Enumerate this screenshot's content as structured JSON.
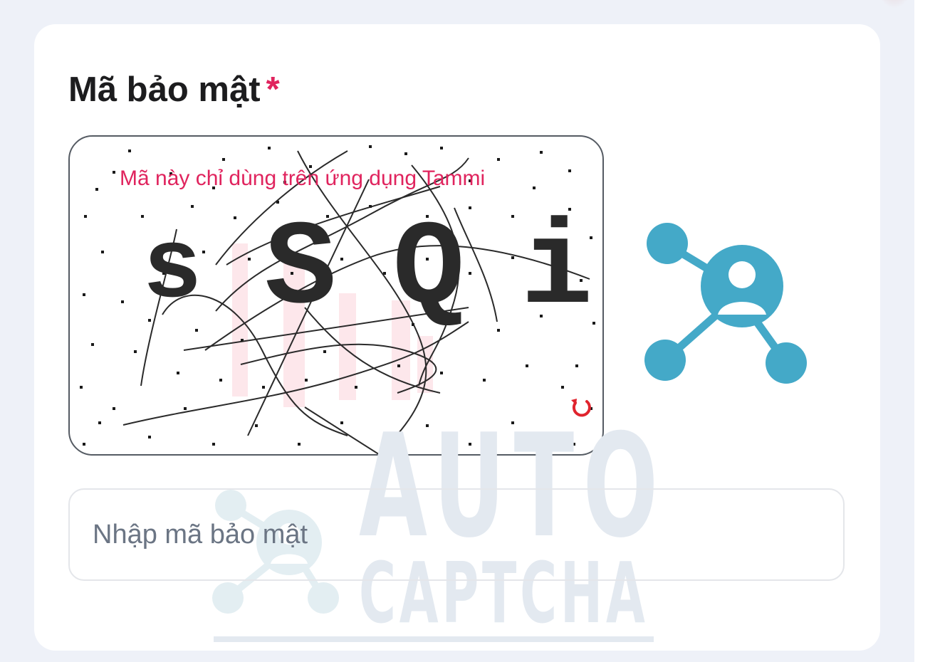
{
  "form": {
    "title": "Mã bảo mật",
    "required_mark": "*",
    "captcha": {
      "notice": "Mã này chỉ dùng trên ứng dụng Tammi",
      "characters": [
        "s",
        "S",
        "Q",
        "i"
      ],
      "refresh_icon": "refresh-icon"
    },
    "input": {
      "value": "",
      "placeholder": "Nhập mã bảo mật"
    }
  },
  "watermark": {
    "line1": "AUTO",
    "line2": "CAPTCHA"
  },
  "colors": {
    "required": "#e0245e",
    "brand_logo": "#44a9c8",
    "placeholder": "#6b7584"
  },
  "icons": {
    "brand_logo": "network-user-icon"
  }
}
